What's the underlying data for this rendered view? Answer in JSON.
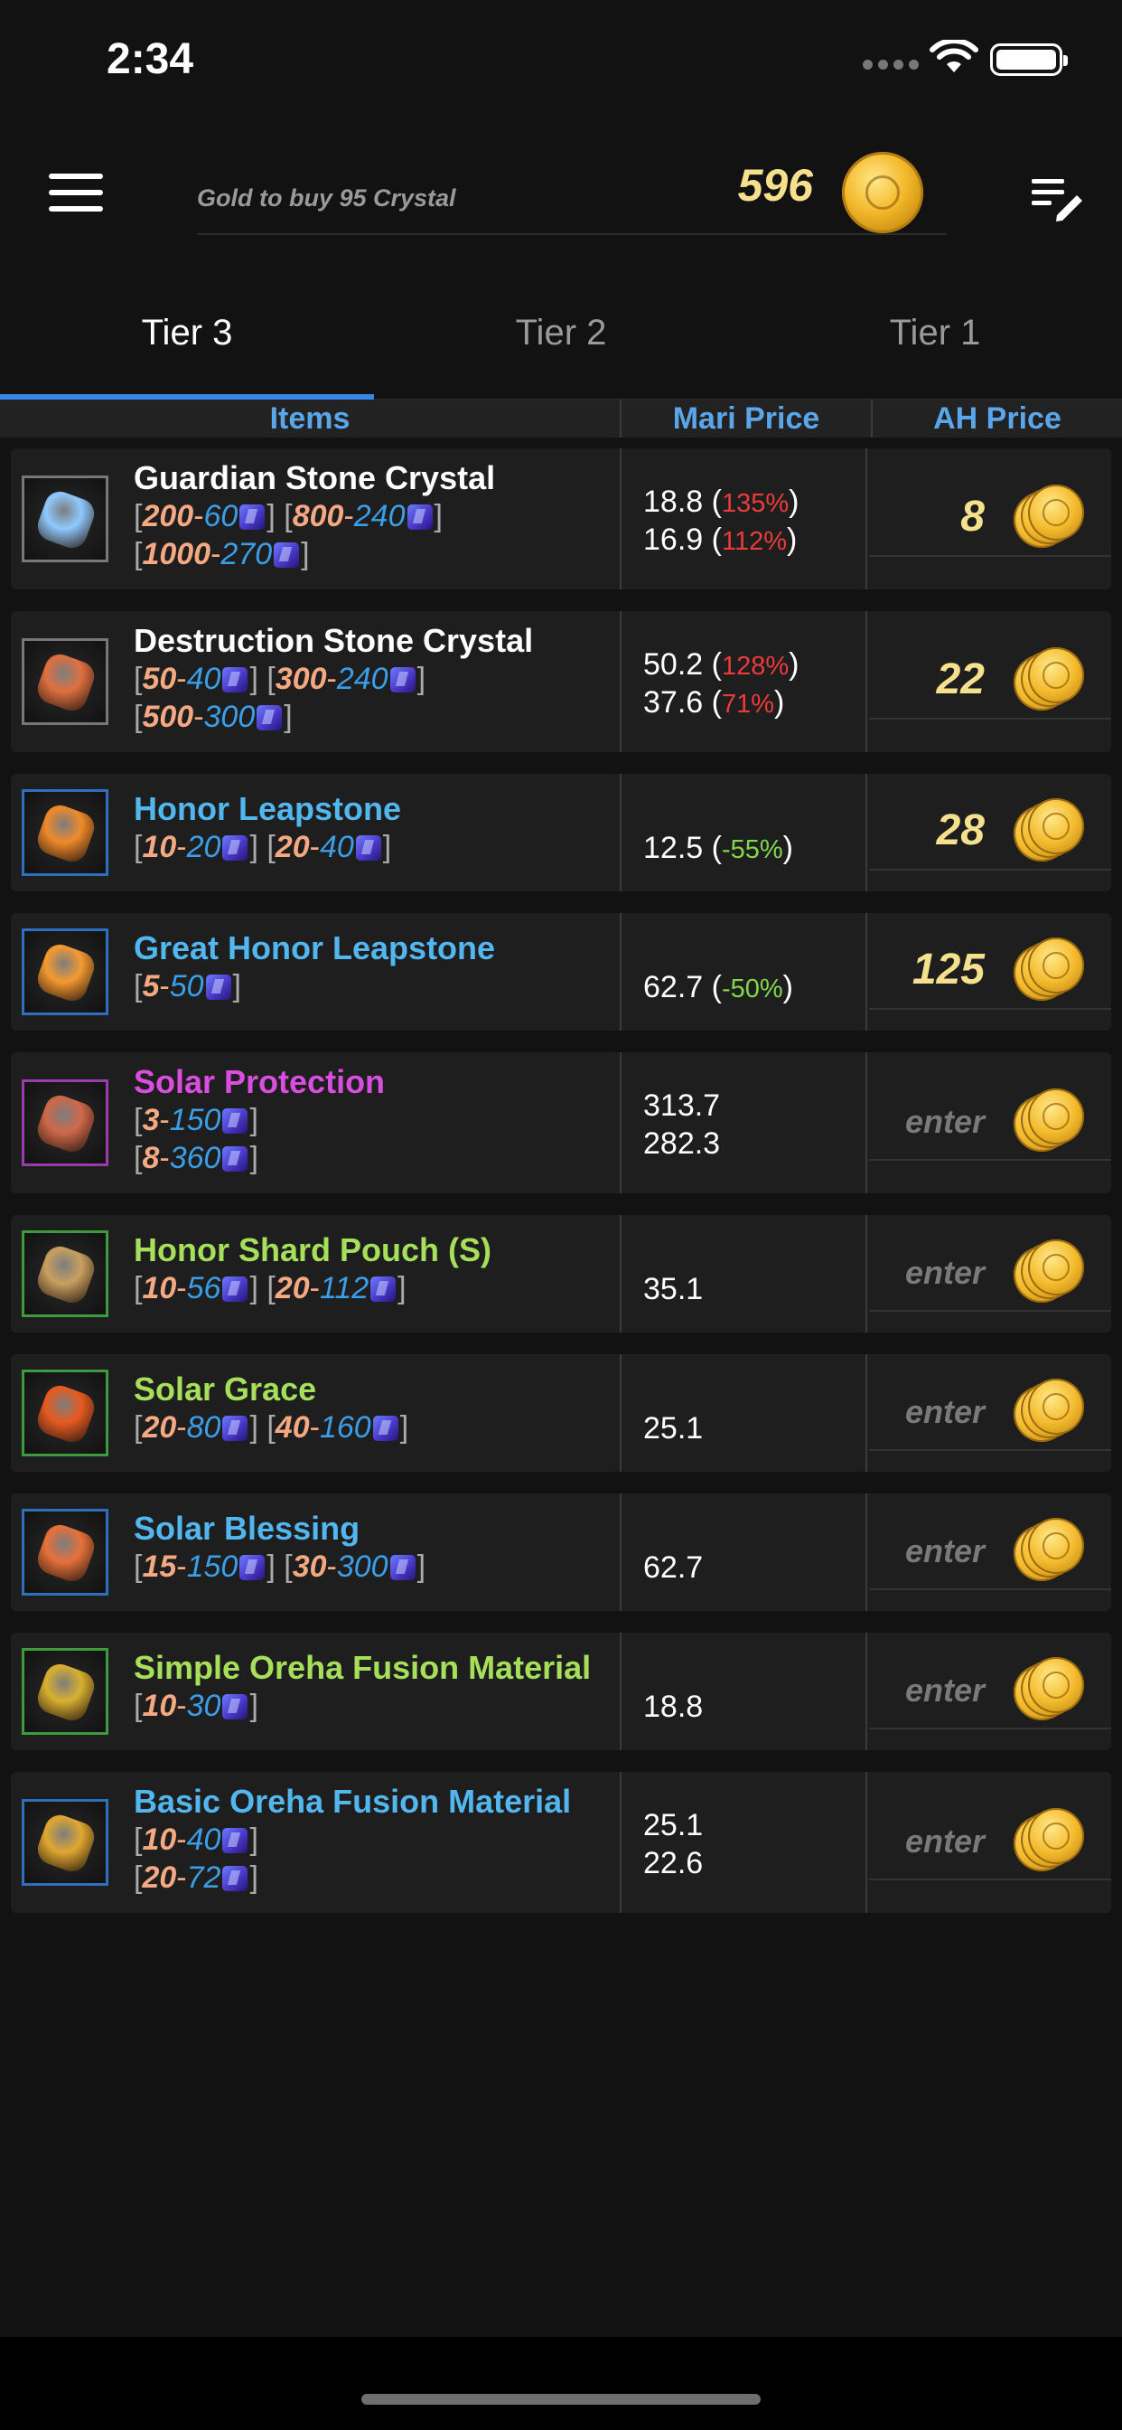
{
  "status_bar": {
    "time": "2:34"
  },
  "header": {
    "gold_label": "Gold to buy 95 Crystal",
    "gold_value": "596"
  },
  "tabs": [
    {
      "label": "Tier 3",
      "active": true
    },
    {
      "label": "Tier 2",
      "active": false
    },
    {
      "label": "Tier 1",
      "active": false
    }
  ],
  "columns": {
    "items": "Items",
    "mari_price": "Mari Price",
    "ah_price": "AH Price"
  },
  "rows": [
    {
      "name": "Guardian Stone Crystal",
      "name_color": "#ffffff",
      "icon_border": "#777777",
      "icon_color": "#8ec9ff",
      "lines": [
        [
          {
            "q": "200",
            "p": "60"
          },
          {
            "q": "800",
            "p": "240"
          }
        ],
        [
          {
            "q": "1000",
            "p": "270"
          }
        ]
      ],
      "mari": [
        {
          "v": "18.8",
          "pct": "135%",
          "pc": "red"
        },
        {
          "v": "16.9",
          "pct": "112%",
          "pc": "red"
        }
      ],
      "ah": "8"
    },
    {
      "name": "Destruction Stone Crystal",
      "name_color": "#ffffff",
      "icon_border": "#777777",
      "icon_color": "#e07040",
      "lines": [
        [
          {
            "q": "50",
            "p": "40"
          },
          {
            "q": "300",
            "p": "240"
          }
        ],
        [
          {
            "q": "500",
            "p": "300"
          }
        ]
      ],
      "mari": [
        {
          "v": "50.2",
          "pct": "128%",
          "pc": "red"
        },
        {
          "v": "37.6",
          "pct": "71%",
          "pc": "red"
        }
      ],
      "ah": "22"
    },
    {
      "name": "Honor Leapstone",
      "name_color": "#52b6ef",
      "icon_border": "#2e6fc0",
      "icon_color": "#f08a2a",
      "lines": [
        [
          {
            "q": "10",
            "p": "20"
          },
          {
            "q": "20",
            "p": "40"
          }
        ]
      ],
      "mari": [
        {
          "v": "12.5",
          "pct": "-55%",
          "pc": "green"
        }
      ],
      "ah": "28"
    },
    {
      "name": "Great Honor Leapstone",
      "name_color": "#52b6ef",
      "icon_border": "#2e6fc0",
      "icon_color": "#f59a30",
      "lines": [
        [
          {
            "q": "5",
            "p": "50"
          }
        ]
      ],
      "mari": [
        {
          "v": "62.7",
          "pct": "-50%",
          "pc": "green"
        }
      ],
      "ah": "125"
    },
    {
      "name": "Solar Protection",
      "name_color": "#d94de0",
      "icon_border": "#9a3bb0",
      "icon_color": "#d0684a",
      "lines": [
        [
          {
            "q": "3",
            "p": "150"
          }
        ],
        [
          {
            "q": "8",
            "p": "360"
          }
        ]
      ],
      "mari": [
        {
          "v": "313.7"
        },
        {
          "v": "282.3"
        }
      ],
      "ah": "enter"
    },
    {
      "name": "Honor Shard Pouch (S)",
      "name_color": "#a6e05a",
      "icon_border": "#3d9a3d",
      "icon_color": "#c8a060",
      "lines": [
        [
          {
            "q": "10",
            "p": "56"
          },
          {
            "q": "20",
            "p": "112"
          }
        ]
      ],
      "mari": [
        {
          "v": "35.1"
        }
      ],
      "ah": "enter"
    },
    {
      "name": "Solar Grace",
      "name_color": "#a6e05a",
      "icon_border": "#3d9a3d",
      "icon_color": "#e85a20",
      "lines": [
        [
          {
            "q": "20",
            "p": "80"
          },
          {
            "q": "40",
            "p": "160"
          }
        ]
      ],
      "mari": [
        {
          "v": "25.1"
        }
      ],
      "ah": "enter"
    },
    {
      "name": "Solar Blessing",
      "name_color": "#52b6ef",
      "icon_border": "#2e6fc0",
      "icon_color": "#e8703a",
      "lines": [
        [
          {
            "q": "15",
            "p": "150"
          },
          {
            "q": "30",
            "p": "300"
          }
        ]
      ],
      "mari": [
        {
          "v": "62.7"
        }
      ],
      "ah": "enter"
    },
    {
      "name": "Simple Oreha Fusion Material",
      "name_color": "#a6e05a",
      "icon_border": "#3d9a3d",
      "icon_color": "#d8b030",
      "lines": [
        [
          {
            "q": "10",
            "p": "30"
          }
        ]
      ],
      "mari": [
        {
          "v": "18.8"
        }
      ],
      "ah": "enter"
    },
    {
      "name": "Basic Oreha Fusion Material",
      "name_color": "#52b6ef",
      "icon_border": "#2e6fc0",
      "icon_color": "#e0a830",
      "lines": [
        [
          {
            "q": "10",
            "p": "40"
          }
        ],
        [
          {
            "q": "20",
            "p": "72"
          }
        ]
      ],
      "mari": [
        {
          "v": "25.1"
        },
        {
          "v": "22.6"
        }
      ],
      "ah": "enter"
    }
  ]
}
